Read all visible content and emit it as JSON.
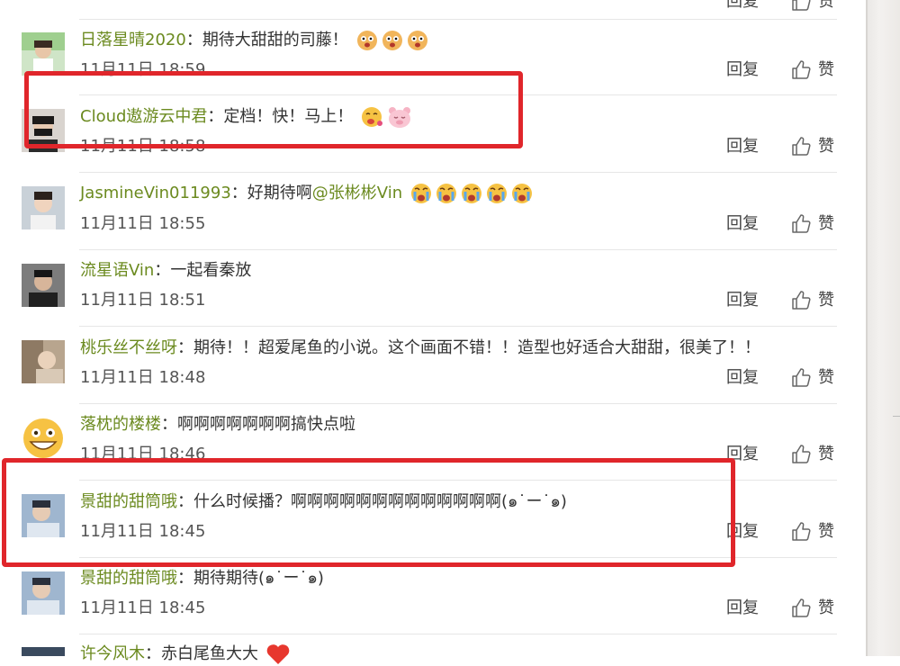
{
  "actions": {
    "reply_label": "回复",
    "like_label": "赞"
  },
  "comments": [
    {
      "username": "日落星晴2020",
      "sep": "：",
      "text": "期待大甜甜的司藤！",
      "emojis": [
        "shock-face",
        "shock-face",
        "shock-face"
      ],
      "time": "11月11日 18:59"
    },
    {
      "username": "Cloud遨游云中君",
      "sep": "：",
      "text": "定档！快！马上！",
      "emojis": [
        "drool-face",
        "pig-face"
      ],
      "time": "11月11日 18:58"
    },
    {
      "username": "JasmineVin011993",
      "sep": "：",
      "text": "好期待啊",
      "mention": "@张彬彬Vin",
      "emojis": [
        "cry-face",
        "cry-face",
        "cry-face",
        "cry-face",
        "cry-face"
      ],
      "time": "11月11日 18:55"
    },
    {
      "username": "流星语Vin",
      "sep": "：",
      "text": "一起看秦放",
      "time": "11月11日 18:51"
    },
    {
      "username": "桃乐丝不丝呀",
      "sep": "：",
      "text": "期待！！超爱尾鱼的小说。这个画面不错！！造型也好适合大甜甜，很美了！！",
      "time": "11月11日 18:48"
    },
    {
      "username": "落枕的楼楼",
      "sep": "：",
      "text": "啊啊啊啊啊啊啊搞快点啦",
      "time": "11月11日 18:46"
    },
    {
      "username": "景甜的甜筒哦",
      "sep": "：",
      "text": "什么时候播？啊啊啊啊啊啊啊啊啊啊啊啊啊(๑˙ー˙๑)",
      "time": "11月11日 18:45"
    },
    {
      "username": "景甜的甜筒哦",
      "sep": "：",
      "text": "期待期待(๑˙ー˙๑)",
      "time": "11月11日 18:45"
    },
    {
      "username": "许今风木",
      "sep": "：",
      "text": "赤白尾鱼大大",
      "emojis": [
        "heart"
      ]
    }
  ],
  "colors": {
    "username": "#6b8a1f",
    "highlight": "#e0262b",
    "text": "#333333"
  }
}
